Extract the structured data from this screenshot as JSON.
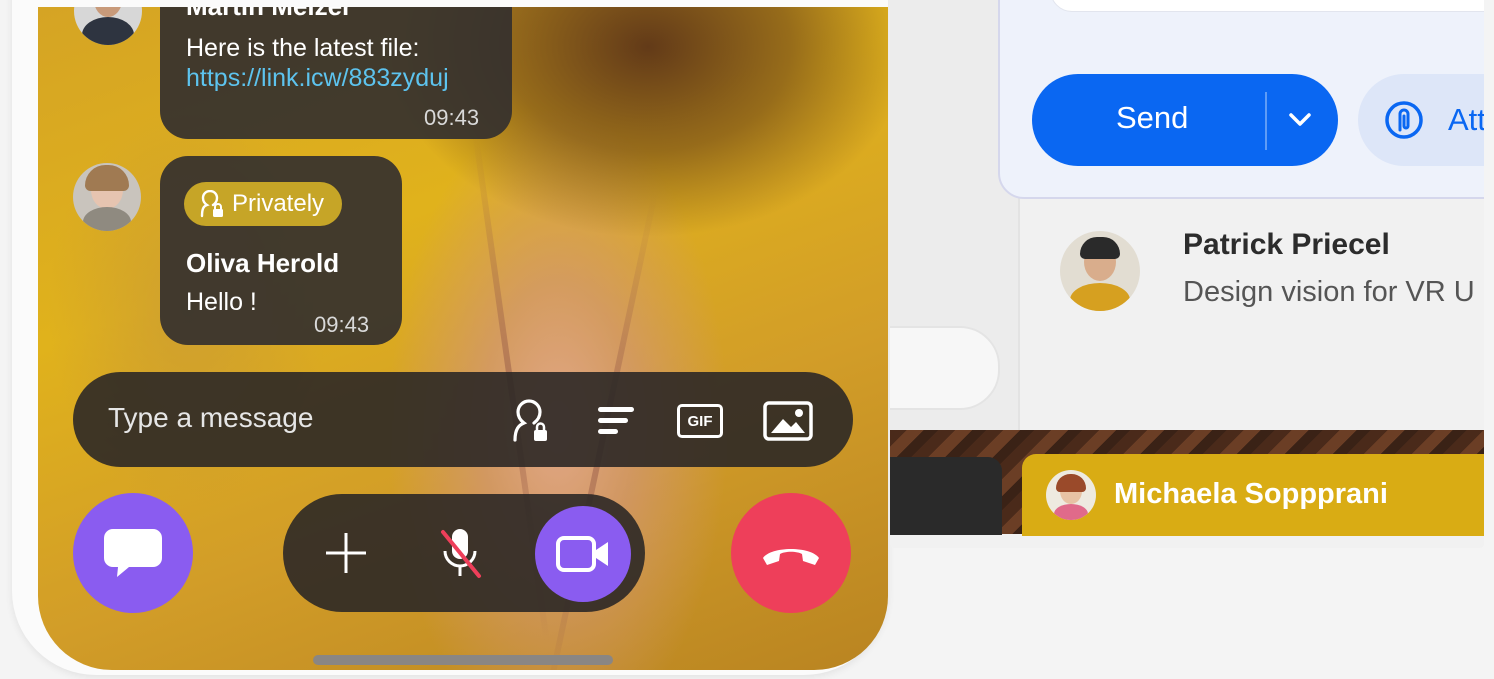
{
  "chat": {
    "messages": [
      {
        "sender": "Martin Melzer",
        "text": "Here is the latest file:",
        "link": "https://link.icw/883zyduj",
        "time": "09:43"
      },
      {
        "badge": "Privately",
        "sender": "Oliva Herold",
        "text": "Hello !",
        "time": "09:43"
      }
    ],
    "composer": {
      "placeholder": "Type a message",
      "gif_label": "GIF"
    }
  },
  "call_controls": {
    "chat_icon": "chat-bubble-icon",
    "add_icon": "plus-icon",
    "mute_icon": "microphone-muted-icon",
    "video_icon": "video-camera-icon",
    "end_icon": "phone-hangup-icon"
  },
  "right_panel": {
    "send_label": "Send",
    "attach_label": "Att",
    "contact": {
      "name": "Patrick Priecel",
      "subtitle": "Design vision for VR U"
    },
    "speaker": {
      "name": "Michaela Soppprani"
    }
  },
  "colors": {
    "send_blue": "#0a67f2",
    "video_purple": "#8a5cf0",
    "hangup_red": "#ee3f5a",
    "badge_gold": "#c6a527",
    "link_blue": "#5dc3ee"
  }
}
